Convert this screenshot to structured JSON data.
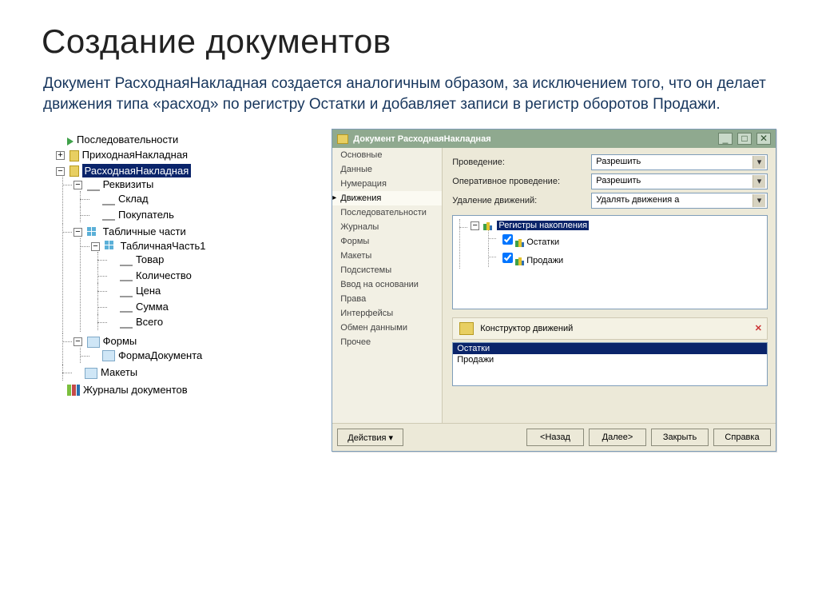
{
  "slide": {
    "title": "Создание документов",
    "desc": "Документ РасходнаяНакладная создается аналогичным образом, за исключением того, что он делает движения типа «расход» по регистру Остатки и добавляет записи в регистр оборотов Продажи."
  },
  "tree": {
    "n0": "Последовательности",
    "n1": "ПриходнаяНакладная",
    "n2": "РасходнаяНакладная",
    "n3": "Реквизиты",
    "n3a": "Склад",
    "n3b": "Покупатель",
    "n4": "Табличные части",
    "n4a": "ТабличнаяЧасть1",
    "n4a1": "Товар",
    "n4a2": "Количество",
    "n4a3": "Цена",
    "n4a4": "Сумма",
    "n4a5": "Всего",
    "n5": "Формы",
    "n5a": "ФормаДокумента",
    "n6": "Макеты",
    "n7": "Журналы документов"
  },
  "dialog": {
    "title": "Документ РасходнаяНакладная",
    "nav": {
      "0": "Основные",
      "1": "Данные",
      "2": "Нумерация",
      "3": "Движения",
      "4": "Последовательности",
      "5": "Журналы",
      "6": "Формы",
      "7": "Макеты",
      "8": "Подсистемы",
      "9": "Ввод на основании",
      "10": "Права",
      "11": "Интерфейсы",
      "12": "Обмен данными",
      "13": "Прочее"
    },
    "labels": {
      "prov": "Проведение:",
      "oper": "Оперативное проведение:",
      "del": "Удаление движений:"
    },
    "values": {
      "prov": "Разрешить",
      "oper": "Разрешить",
      "del": "Удалять движения а"
    },
    "regsRoot": "Регистры накопления",
    "reg1": "Остатки",
    "reg2": "Продажи",
    "wizard": "Конструктор движений",
    "list": {
      "0": "Остатки",
      "1": "Продажи"
    },
    "buttons": {
      "act": "Действия",
      "back": "<Назад",
      "next": "Далее>",
      "close": "Закрыть",
      "help": "Справка"
    }
  }
}
